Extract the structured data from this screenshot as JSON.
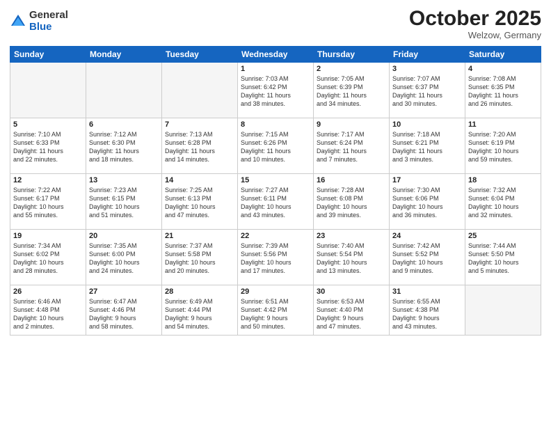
{
  "logo": {
    "general": "General",
    "blue": "Blue"
  },
  "header": {
    "month": "October 2025",
    "location": "Welzow, Germany"
  },
  "weekdays": [
    "Sunday",
    "Monday",
    "Tuesday",
    "Wednesday",
    "Thursday",
    "Friday",
    "Saturday"
  ],
  "weeks": [
    [
      {
        "day": "",
        "info": ""
      },
      {
        "day": "",
        "info": ""
      },
      {
        "day": "",
        "info": ""
      },
      {
        "day": "1",
        "info": "Sunrise: 7:03 AM\nSunset: 6:42 PM\nDaylight: 11 hours\nand 38 minutes."
      },
      {
        "day": "2",
        "info": "Sunrise: 7:05 AM\nSunset: 6:39 PM\nDaylight: 11 hours\nand 34 minutes."
      },
      {
        "day": "3",
        "info": "Sunrise: 7:07 AM\nSunset: 6:37 PM\nDaylight: 11 hours\nand 30 minutes."
      },
      {
        "day": "4",
        "info": "Sunrise: 7:08 AM\nSunset: 6:35 PM\nDaylight: 11 hours\nand 26 minutes."
      }
    ],
    [
      {
        "day": "5",
        "info": "Sunrise: 7:10 AM\nSunset: 6:33 PM\nDaylight: 11 hours\nand 22 minutes."
      },
      {
        "day": "6",
        "info": "Sunrise: 7:12 AM\nSunset: 6:30 PM\nDaylight: 11 hours\nand 18 minutes."
      },
      {
        "day": "7",
        "info": "Sunrise: 7:13 AM\nSunset: 6:28 PM\nDaylight: 11 hours\nand 14 minutes."
      },
      {
        "day": "8",
        "info": "Sunrise: 7:15 AM\nSunset: 6:26 PM\nDaylight: 11 hours\nand 10 minutes."
      },
      {
        "day": "9",
        "info": "Sunrise: 7:17 AM\nSunset: 6:24 PM\nDaylight: 11 hours\nand 7 minutes."
      },
      {
        "day": "10",
        "info": "Sunrise: 7:18 AM\nSunset: 6:21 PM\nDaylight: 11 hours\nand 3 minutes."
      },
      {
        "day": "11",
        "info": "Sunrise: 7:20 AM\nSunset: 6:19 PM\nDaylight: 10 hours\nand 59 minutes."
      }
    ],
    [
      {
        "day": "12",
        "info": "Sunrise: 7:22 AM\nSunset: 6:17 PM\nDaylight: 10 hours\nand 55 minutes."
      },
      {
        "day": "13",
        "info": "Sunrise: 7:23 AM\nSunset: 6:15 PM\nDaylight: 10 hours\nand 51 minutes."
      },
      {
        "day": "14",
        "info": "Sunrise: 7:25 AM\nSunset: 6:13 PM\nDaylight: 10 hours\nand 47 minutes."
      },
      {
        "day": "15",
        "info": "Sunrise: 7:27 AM\nSunset: 6:11 PM\nDaylight: 10 hours\nand 43 minutes."
      },
      {
        "day": "16",
        "info": "Sunrise: 7:28 AM\nSunset: 6:08 PM\nDaylight: 10 hours\nand 39 minutes."
      },
      {
        "day": "17",
        "info": "Sunrise: 7:30 AM\nSunset: 6:06 PM\nDaylight: 10 hours\nand 36 minutes."
      },
      {
        "day": "18",
        "info": "Sunrise: 7:32 AM\nSunset: 6:04 PM\nDaylight: 10 hours\nand 32 minutes."
      }
    ],
    [
      {
        "day": "19",
        "info": "Sunrise: 7:34 AM\nSunset: 6:02 PM\nDaylight: 10 hours\nand 28 minutes."
      },
      {
        "day": "20",
        "info": "Sunrise: 7:35 AM\nSunset: 6:00 PM\nDaylight: 10 hours\nand 24 minutes."
      },
      {
        "day": "21",
        "info": "Sunrise: 7:37 AM\nSunset: 5:58 PM\nDaylight: 10 hours\nand 20 minutes."
      },
      {
        "day": "22",
        "info": "Sunrise: 7:39 AM\nSunset: 5:56 PM\nDaylight: 10 hours\nand 17 minutes."
      },
      {
        "day": "23",
        "info": "Sunrise: 7:40 AM\nSunset: 5:54 PM\nDaylight: 10 hours\nand 13 minutes."
      },
      {
        "day": "24",
        "info": "Sunrise: 7:42 AM\nSunset: 5:52 PM\nDaylight: 10 hours\nand 9 minutes."
      },
      {
        "day": "25",
        "info": "Sunrise: 7:44 AM\nSunset: 5:50 PM\nDaylight: 10 hours\nand 5 minutes."
      }
    ],
    [
      {
        "day": "26",
        "info": "Sunrise: 6:46 AM\nSunset: 4:48 PM\nDaylight: 10 hours\nand 2 minutes."
      },
      {
        "day": "27",
        "info": "Sunrise: 6:47 AM\nSunset: 4:46 PM\nDaylight: 9 hours\nand 58 minutes."
      },
      {
        "day": "28",
        "info": "Sunrise: 6:49 AM\nSunset: 4:44 PM\nDaylight: 9 hours\nand 54 minutes."
      },
      {
        "day": "29",
        "info": "Sunrise: 6:51 AM\nSunset: 4:42 PM\nDaylight: 9 hours\nand 50 minutes."
      },
      {
        "day": "30",
        "info": "Sunrise: 6:53 AM\nSunset: 4:40 PM\nDaylight: 9 hours\nand 47 minutes."
      },
      {
        "day": "31",
        "info": "Sunrise: 6:55 AM\nSunset: 4:38 PM\nDaylight: 9 hours\nand 43 minutes."
      },
      {
        "day": "",
        "info": ""
      }
    ]
  ]
}
